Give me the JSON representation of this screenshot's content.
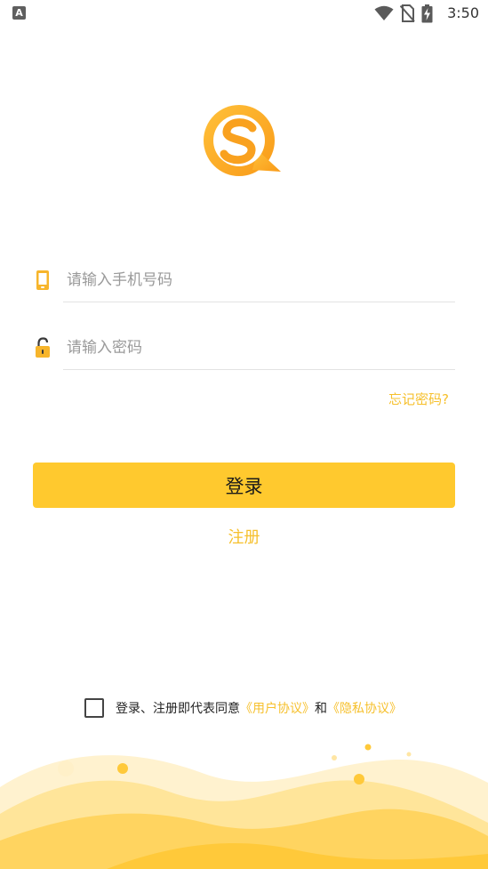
{
  "status_bar": {
    "left_icon_letter": "A",
    "time": "3:50",
    "icons": [
      "wifi-icon",
      "no-sim-icon",
      "battery-charging-icon"
    ]
  },
  "brand": {
    "logo_icon": "chat-s-logo-icon",
    "accent_color": "#ffc92e",
    "link_color": "#f6c02d"
  },
  "login_form": {
    "phone": {
      "icon": "phone-icon",
      "value": "",
      "placeholder": "请输入手机号码"
    },
    "password": {
      "icon": "unlocked-padlock-icon",
      "value": "",
      "placeholder": "请输入密码"
    },
    "forgot_label": "忘记密码?",
    "login_label": "登录",
    "register_label": "注册"
  },
  "agreement": {
    "checked": false,
    "prefix": "登录、注册即代表同意",
    "user_agreement": "《用户协议》",
    "conjunction": "和",
    "privacy_policy": "《隐私协议》"
  }
}
